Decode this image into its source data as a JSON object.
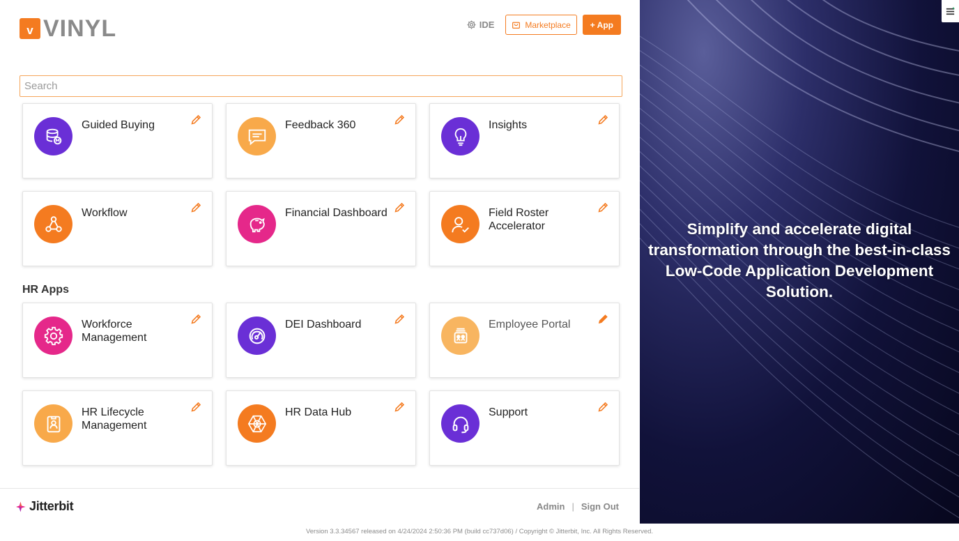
{
  "header": {
    "logo_badge": "v",
    "logo_text": "VINYL",
    "ide_label": "IDE",
    "marketplace_label": "Marketplace",
    "add_app_label": "+ App"
  },
  "search": {
    "placeholder": "Search"
  },
  "apps": [
    {
      "title": "Guided Buying",
      "icon": "database-icon",
      "color": "#6a2fd6"
    },
    {
      "title": "Feedback 360",
      "icon": "chat-icon",
      "color": "#f8a94a"
    },
    {
      "title": "Insights",
      "icon": "lightbulb-icon",
      "color": "#6a2fd6"
    },
    {
      "title": "Workflow",
      "icon": "workflow-icon",
      "color": "#f47b20"
    },
    {
      "title": "Financial Dashboard",
      "icon": "piggy-bank-icon",
      "color": "#e5288a"
    },
    {
      "title": "Field Roster Accelerator",
      "icon": "user-check-icon",
      "color": "#f47b20"
    }
  ],
  "hr_section": {
    "title": "HR Apps"
  },
  "hr_apps": [
    {
      "title": "Workforce Management",
      "icon": "gear-icon",
      "color": "#e5288a"
    },
    {
      "title": "DEI Dashboard",
      "icon": "gauge-icon",
      "color": "#6a2fd6"
    },
    {
      "title": "Employee Portal",
      "icon": "portal-icon",
      "color": "#f8b560"
    },
    {
      "title": "HR Lifecycle Management",
      "icon": "badge-icon",
      "color": "#f8a94a"
    },
    {
      "title": "HR Data Hub",
      "icon": "hub-icon",
      "color": "#f47b20"
    },
    {
      "title": "Support",
      "icon": "headset-icon",
      "color": "#6a2fd6"
    }
  ],
  "footer": {
    "brand": "Jitterbit",
    "admin_label": "Admin",
    "separator": "|",
    "signout_label": "Sign Out",
    "version": "Version 3.3.34567 released on 4/24/2024 2:50:36 PM (build cc737d06) / Copyright © Jitterbit, Inc. All Rights Reserved."
  },
  "hero": {
    "tagline": "Simplify and accelerate digital transformation through the best-in-class Low-Code Application Development Solution."
  },
  "colors": {
    "accent": "#f47b20",
    "purple": "#6a2fd6",
    "pink": "#e5288a",
    "light_orange": "#f8a94a"
  }
}
